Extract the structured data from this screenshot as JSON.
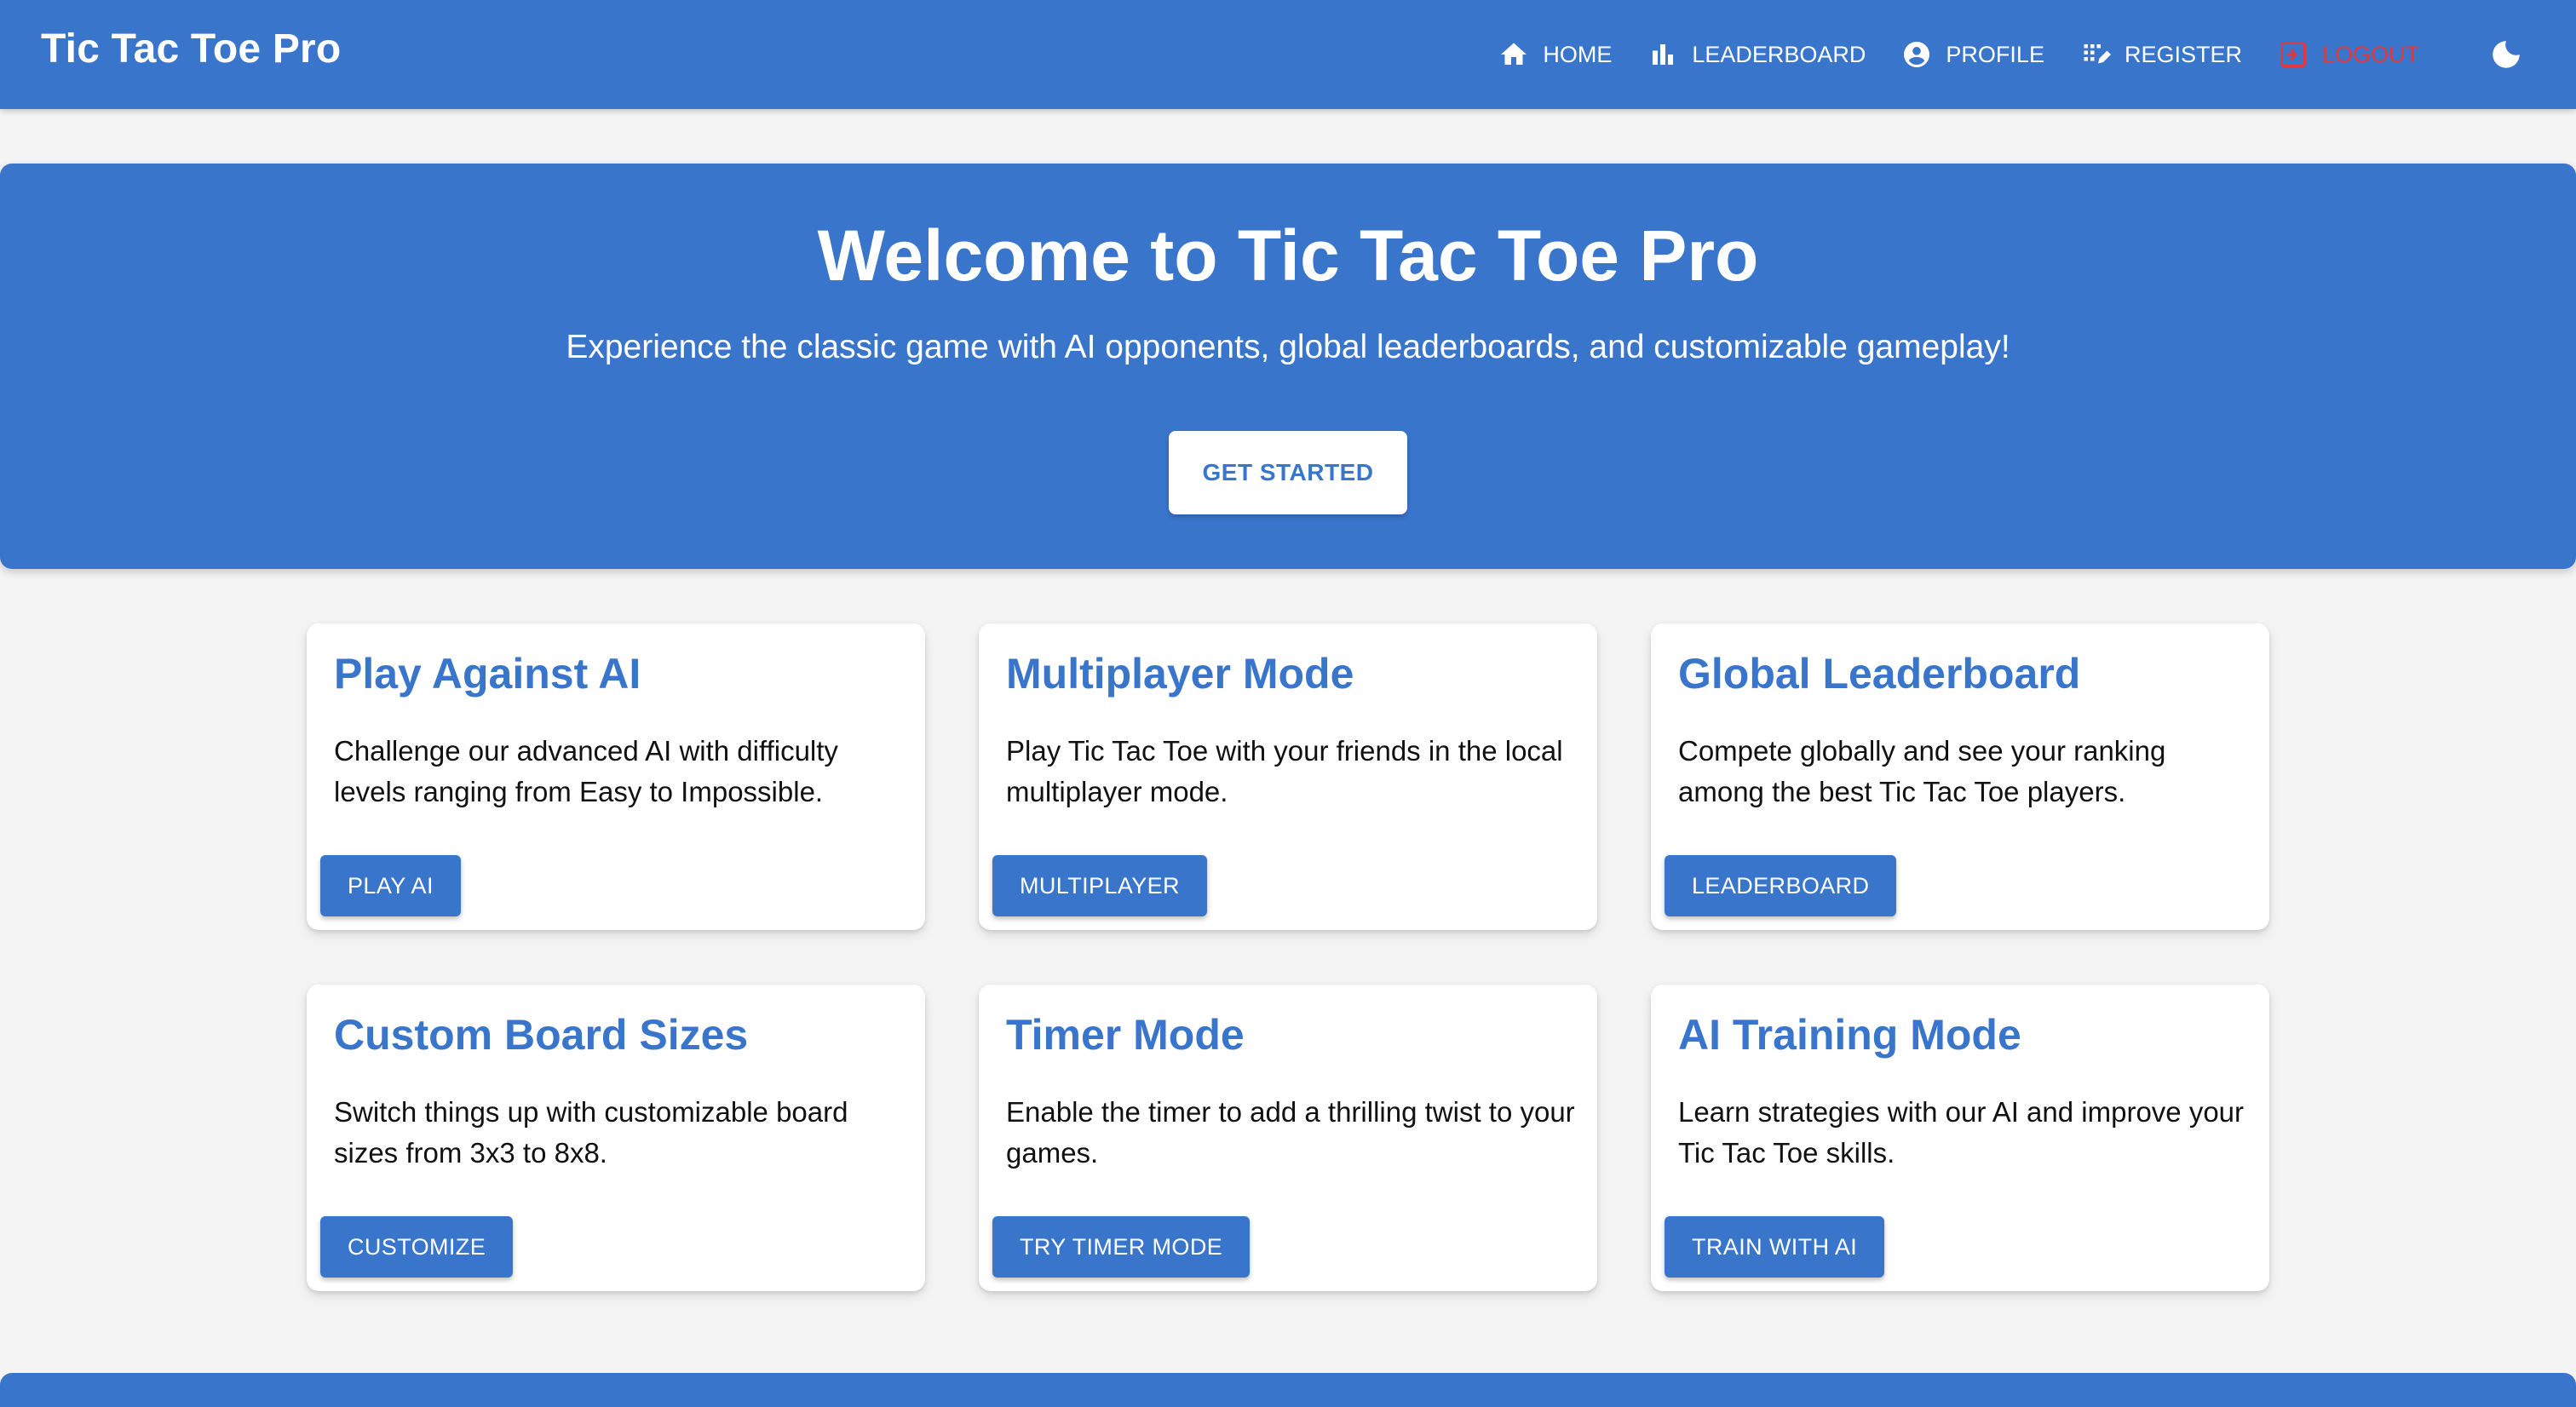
{
  "app": {
    "brand": "Tic Tac Toe Pro"
  },
  "nav": {
    "items": [
      {
        "label": "HOME",
        "icon": "home-icon"
      },
      {
        "label": "LEADERBOARD",
        "icon": "bar-chart-icon"
      },
      {
        "label": "PROFILE",
        "icon": "account-circle-icon"
      },
      {
        "label": "REGISTER",
        "icon": "register-icon"
      },
      {
        "label": "LOGOUT",
        "icon": "logout-icon"
      }
    ],
    "theme_toggle_icon": "moon-icon"
  },
  "hero": {
    "title": "Welcome to Tic Tac Toe Pro",
    "subtitle": "Experience the classic game with AI opponents, global leaderboards, and customizable gameplay!",
    "cta": "GET STARTED"
  },
  "features": [
    {
      "title": "Play Against AI",
      "text": "Challenge our advanced AI with difficulty levels ranging from Easy to Impossible.",
      "button": "PLAY AI"
    },
    {
      "title": "Multiplayer Mode",
      "text": "Play Tic Tac Toe with your friends in the local multiplayer mode.",
      "button": "MULTIPLAYER"
    },
    {
      "title": "Global Leaderboard",
      "text": "Compete globally and see your ranking among the best Tic Tac Toe players.",
      "button": "LEADERBOARD"
    },
    {
      "title": "Custom Board Sizes",
      "text": "Switch things up with customizable board sizes from 3x3 to 8x8.",
      "button": "CUSTOMIZE"
    },
    {
      "title": "Timer Mode",
      "text": "Enable the timer to add a thrilling twist to your games.",
      "button": "TRY TIMER MODE"
    },
    {
      "title": "AI Training Mode",
      "text": "Learn strategies with our AI and improve your Tic Tac Toe skills.",
      "button": "TRAIN WITH AI"
    }
  ],
  "colors": {
    "primary": "#3a75cc",
    "logout": "#e0383e",
    "background": "#f4f4f5"
  }
}
